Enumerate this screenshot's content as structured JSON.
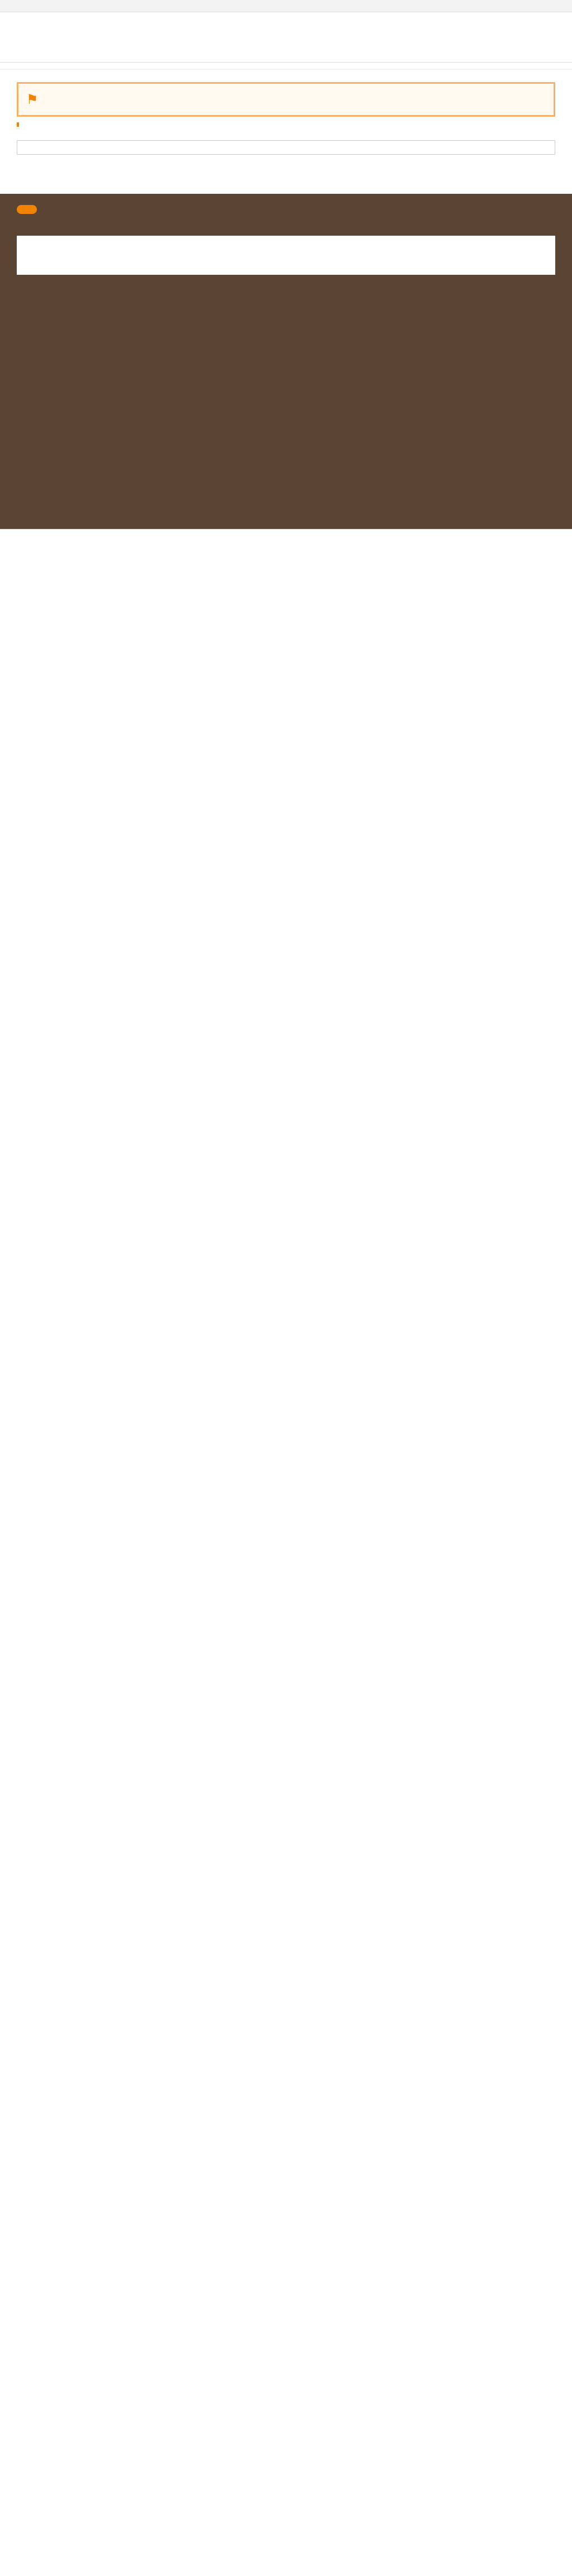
{
  "top_strip": {
    "brand": "",
    "links": []
  },
  "header": {
    "logo": "",
    "nav": [],
    "tools": []
  },
  "intro_text": "",
  "breadcrumb": [],
  "title": "",
  "lead": "",
  "companies": [],
  "rankings": [],
  "other_info": {
    "heading": "",
    "links": []
  },
  "related": [],
  "ads": [],
  "footer": {
    "logo": "",
    "intro": "",
    "columns": [],
    "keywords_heading": "",
    "keywords": []
  },
  "footer_bottom": {
    "company": "",
    "links": [],
    "copyright": ""
  }
}
